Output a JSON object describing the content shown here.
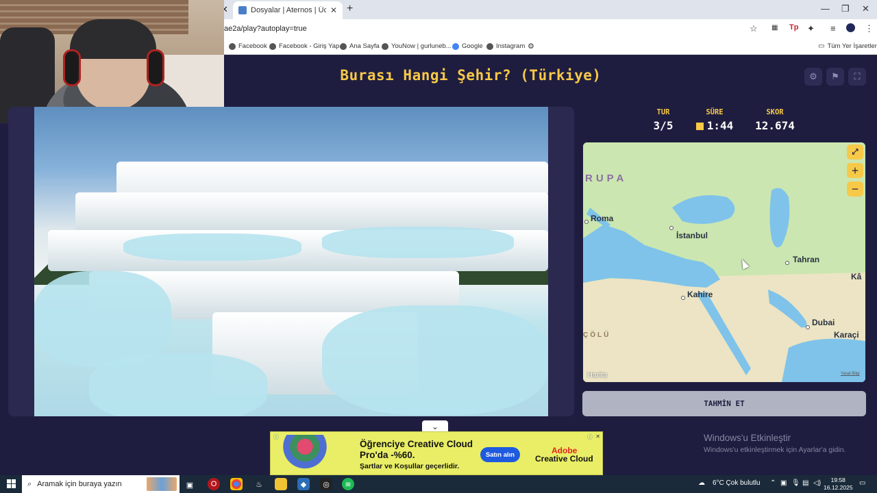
{
  "browser": {
    "tab_title": "Dosyalar | Aternos | Ücretsiz M...",
    "url": "ae2a/play?autoplay=true",
    "bookmarks": [
      "Facebook",
      "Facebook - Giriş Yap...",
      "Ana Sayfa",
      "YouNow | gurluneb...",
      "Google",
      "Instagram"
    ],
    "all_bookmarks": "Tüm Yer İşaretleri"
  },
  "game": {
    "title": "Burası Hangi Şehir? (Türkiye)",
    "stats": {
      "round_label": "TUR",
      "round_value": "3/5",
      "time_label": "SÜRE",
      "time_value": "1:44",
      "score_label": "SKOR",
      "score_value": "12.674"
    },
    "guess_button": "TAHMİN ET"
  },
  "map": {
    "labels": {
      "europe": "RUPA",
      "roma": "Roma",
      "istanbul": "İstanbul",
      "tahran": "Tahran",
      "kahire": "Kahire",
      "dubai": "Dubai",
      "karachi": "Karaçi",
      "desert": "ÇÖLÜ",
      "edge": "Kâ"
    },
    "brand": "Harita",
    "legal": "Yasal Bilgi"
  },
  "ad": {
    "headline": "Öğrenciye Creative Cloud Pro'da -%60.",
    "sub": "Şartlar ve Koşullar geçerlidir.",
    "cta": "Satın alın",
    "brand_line1": "Adobe",
    "brand_line2": "Creative Cloud"
  },
  "windows_activation": {
    "title": "Windows'u Etkinleştir",
    "subtitle": "Windows'u etkinleştirmek için Ayarlar'a gidin."
  },
  "taskbar": {
    "search_placeholder": "Aramak için buraya yazın",
    "weather": "6°C  Çok bulutlu",
    "time": "19:58",
    "date": "16.12.2025"
  }
}
